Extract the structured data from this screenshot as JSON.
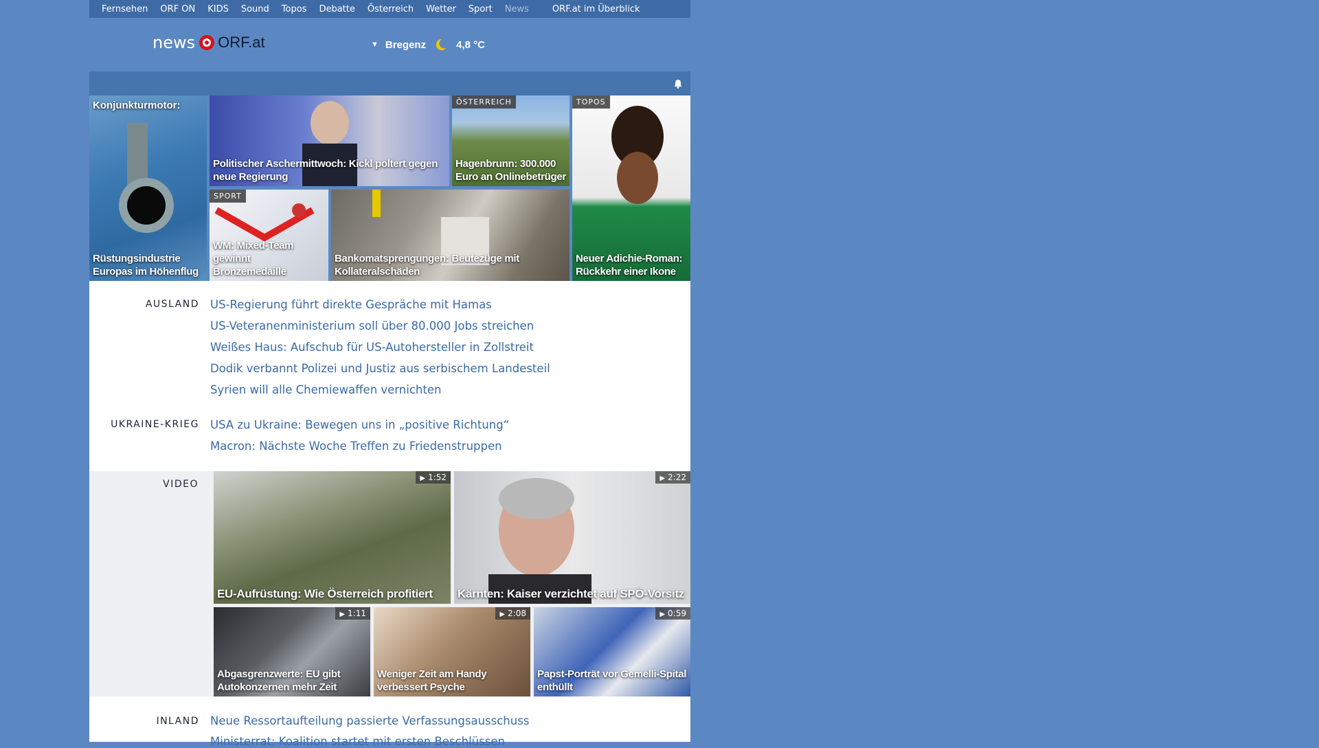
{
  "topnav": {
    "items": [
      "Fernsehen",
      "ORF ON",
      "KIDS",
      "Sound",
      "Topos",
      "Debatte",
      "Österreich",
      "Wetter",
      "Sport",
      "News"
    ],
    "active": "News",
    "overview": "ORF.at im Überblick"
  },
  "logo": {
    "prefix": "news",
    "brand": "ORF.at"
  },
  "weather": {
    "arrow": "▼",
    "location": "Bregenz",
    "temperature": "4,8 °C",
    "icon": "moon-icon"
  },
  "hero": {
    "t1": {
      "caption_top": "Konjunkturmotor:",
      "caption": "Rüstungsindustrie Europas im Höhenflug"
    },
    "t2": {
      "caption": "Politischer Aschermittwoch: Kickl poltert gegen neue Regierung"
    },
    "t3": {
      "badge": "ÖSTERREICH",
      "caption": "Hagenbrunn: 300.000 Euro an Onlinebetrüger"
    },
    "t4": {
      "badge": "TOPOS",
      "caption": "Neuer Adichie-Roman: Rückkehr einer Ikone"
    },
    "t5": {
      "badge": "SPORT",
      "caption": "WM: Mixed-Team gewinnt Bronzemedaille"
    },
    "t6": {
      "caption": "Bankomatsprengungen: Beutezüge mit Kollateralschäden"
    }
  },
  "sections": {
    "ausland": {
      "label": "AUSLAND",
      "stories": [
        "US-Regierung führt direkte Gespräche mit Hamas",
        "US-Veteranenministerium soll über 80.000 Jobs streichen",
        "Weißes Haus: Aufschub für US-Autohersteller in Zollstreit",
        "Dodik verbannt Polizei und Justiz aus serbischem Landesteil",
        "Syrien will alle Chemiewaffen vernichten"
      ]
    },
    "ukraine": {
      "label": "UKRAINE-KRIEG",
      "stories": [
        "USA zu Ukraine: Bewegen uns in „positive Richtung“",
        "Macron: Nächste Woche Treffen zu Friedenstruppen"
      ]
    },
    "video": {
      "label": "VIDEO",
      "items": [
        {
          "duration": "1:52",
          "caption": "EU-Aufrüstung: Wie Österreich profitiert"
        },
        {
          "duration": "2:22",
          "caption": "Kärnten: Kaiser verzichtet auf SPÖ-Vorsitz"
        },
        {
          "duration": "1:11",
          "caption": "Abgasgrenzwerte: EU gibt Autokonzernen mehr Zeit"
        },
        {
          "duration": "2:08",
          "caption": "Weniger Zeit am Handy verbessert Psyche"
        },
        {
          "duration": "0:59",
          "caption": "Papst-Porträt vor Gemelli-Spital enthüllt"
        }
      ]
    },
    "inland": {
      "label": "INLAND",
      "stories": [
        "Neue Ressortaufteilung passierte Verfassungsausschuss",
        "Ministerrat: Koalition startet mit ersten Beschlüssen"
      ]
    }
  },
  "colors": {
    "background": "#5b88c3",
    "topnav": "#3e6ba6",
    "link": "#3a6aa7",
    "orf_red": "#d8111f"
  }
}
